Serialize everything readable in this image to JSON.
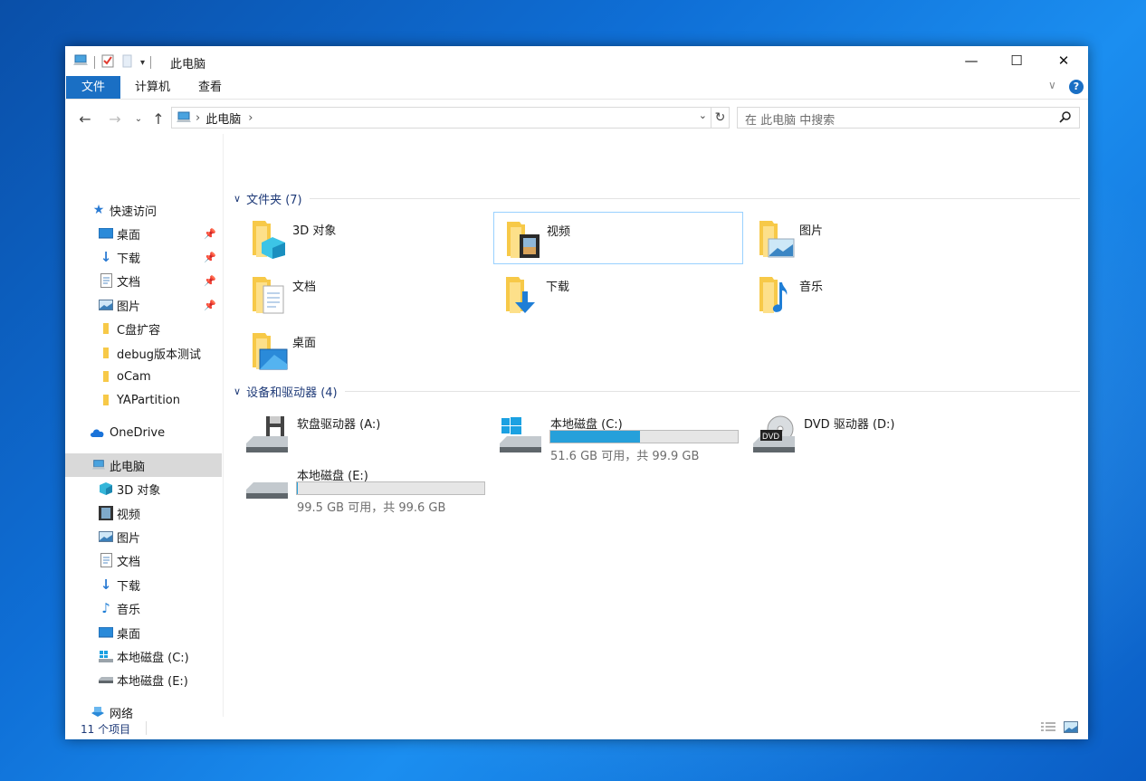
{
  "window": {
    "title": "此电脑",
    "minimize": "—",
    "maximize": "☐",
    "close": "✕"
  },
  "ribbon": {
    "tabs": [
      "文件",
      "计算机",
      "查看"
    ],
    "help": "?",
    "expand": "∨"
  },
  "address": {
    "path": "此电脑",
    "search_placeholder": "在 此电脑 中搜索"
  },
  "sidebar": {
    "quick_access": "快速访问",
    "quick_items": [
      "桌面",
      "下载",
      "文档",
      "图片",
      "C盘扩容",
      "debug版本测试",
      "oCam",
      "YAPartition"
    ],
    "onedrive": "OneDrive",
    "this_pc": "此电脑",
    "pc_items": [
      "3D 对象",
      "视频",
      "图片",
      "文档",
      "下载",
      "音乐",
      "桌面",
      "本地磁盘 (C:)",
      "本地磁盘 (E:)"
    ],
    "network": "网络"
  },
  "content": {
    "folders_header": "文件夹 (7)",
    "folders": [
      "3D 对象",
      "视频",
      "图片",
      "文档",
      "下载",
      "音乐",
      "桌面"
    ],
    "devices_header": "设备和驱动器 (4)",
    "drives": [
      {
        "name": "软盘驱动器 (A:)"
      },
      {
        "name": "本地磁盘 (C:)",
        "free": "51.6 GB 可用，共 99.9 GB",
        "used_fraction": 0.48
      },
      {
        "name": "DVD 驱动器 (D:)"
      },
      {
        "name": "本地磁盘 (E:)",
        "free": "99.5 GB 可用，共 99.6 GB",
        "used_fraction": 0.001
      }
    ]
  },
  "status": {
    "count": "11 个项目"
  },
  "colors": {
    "accent": "#1a6fc4",
    "progress": "#26a0da",
    "folder": "#f7c948"
  }
}
